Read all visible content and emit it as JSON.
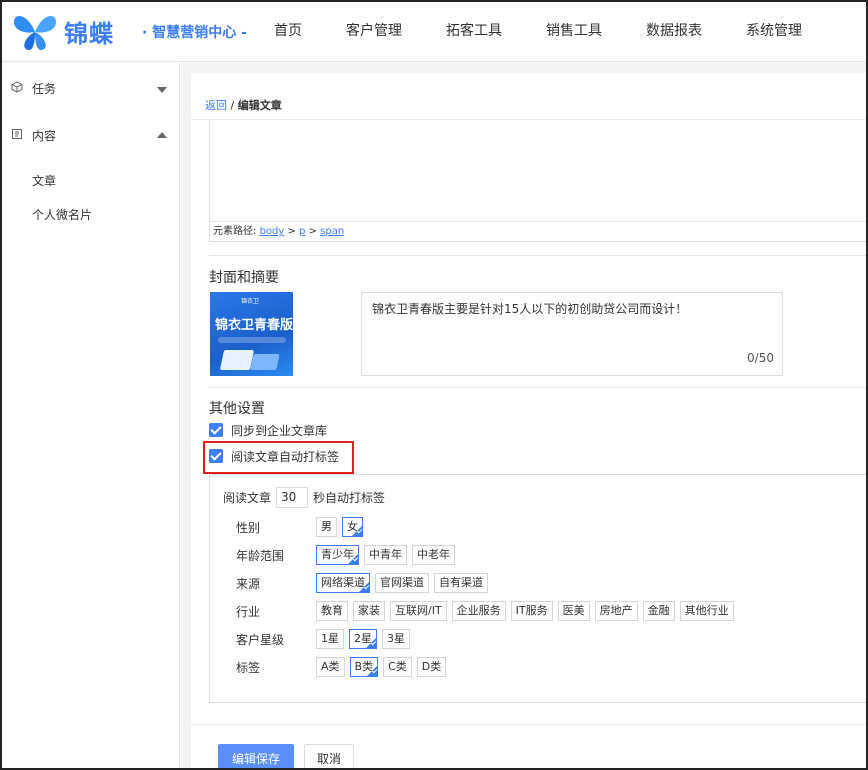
{
  "header": {
    "brand": "锦蝶",
    "slogan": "· 智慧营销中心 -",
    "nav": [
      "首页",
      "客户管理",
      "拓客工具",
      "销售工具",
      "数据报表",
      "系统管理"
    ]
  },
  "sidebar": {
    "groups": [
      {
        "label": "任务",
        "icon": "cube-icon",
        "expanded": false
      },
      {
        "label": "内容",
        "icon": "document-icon",
        "expanded": true
      }
    ],
    "subitems": [
      "文章",
      "个人微名片"
    ]
  },
  "breadcrumb": {
    "back": "返回",
    "sep": " / ",
    "current": "编辑文章"
  },
  "editor": {
    "path_label": "元素路径:",
    "path": [
      "body",
      "p",
      "span"
    ],
    "path_sep": " > "
  },
  "cover_section": {
    "title": "封面和摘要",
    "cover_logo": "锦衣卫",
    "cover_title": "锦衣卫青春版",
    "summary": "锦衣卫青春版主要是针对15人以下的初创助贷公司而设计！",
    "count": "0/50"
  },
  "other_settings": {
    "title": "其他设置",
    "sync_label": "同步到企业文章库",
    "sync_checked": true,
    "autotag_label": "阅读文章自动打标签",
    "autotag_checked": true
  },
  "tag_panel": {
    "read_prefix": "阅读文章",
    "read_seconds": "30",
    "read_suffix": "秒自动打标签",
    "rows": [
      {
        "label": "性别",
        "options": [
          "男",
          "女"
        ],
        "selected": [
          "女"
        ]
      },
      {
        "label": "年龄范围",
        "options": [
          "青少年",
          "中青年",
          "中老年"
        ],
        "selected": [
          "青少年"
        ]
      },
      {
        "label": "来源",
        "options": [
          "网络渠道",
          "官网渠道",
          "自有渠道"
        ],
        "selected": [
          "网络渠道"
        ]
      },
      {
        "label": "行业",
        "options": [
          "教育",
          "家装",
          "互联网/IT",
          "企业服务",
          "IT服务",
          "医美",
          "房地产",
          "金融",
          "其他行业"
        ],
        "selected": []
      },
      {
        "label": "客户星级",
        "options": [
          "1星",
          "2星",
          "3星"
        ],
        "selected": [
          "2星"
        ]
      },
      {
        "label": "标签",
        "options": [
          "A类",
          "B类",
          "C类",
          "D类"
        ],
        "selected": [
          "B类"
        ]
      }
    ]
  },
  "actions": {
    "save": "编辑保存",
    "cancel": "取消"
  },
  "colors": {
    "accent": "#3d7df6",
    "highlight": "#e02020",
    "save_button": "#5b8ff9"
  }
}
